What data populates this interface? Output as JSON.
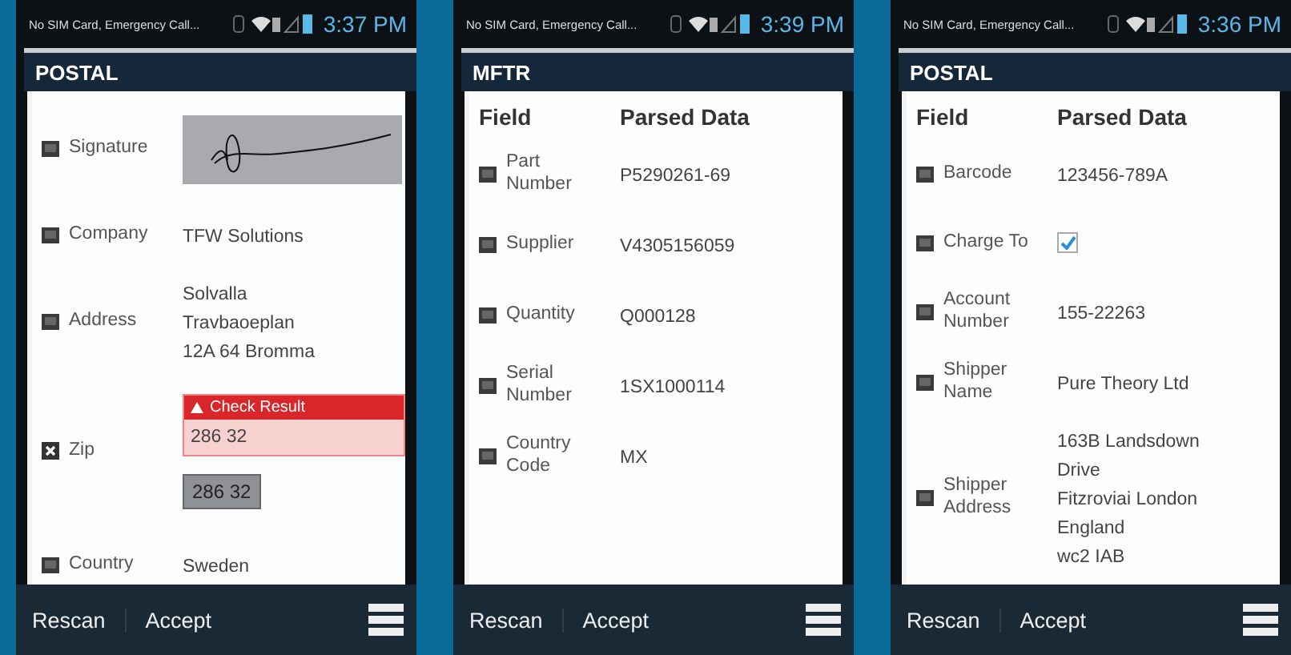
{
  "phones": [
    {
      "status_bar": {
        "carrier": "No SIM Card, Emergency Call...",
        "time": "3:37 PM"
      },
      "title": "POSTAL",
      "rows": [
        {
          "kind": "signature",
          "label": "Signature",
          "error": false
        },
        {
          "kind": "text",
          "label": "Company",
          "error": false,
          "value": "TFW Solutions"
        },
        {
          "kind": "text",
          "label": "Address",
          "error": false,
          "value": "Solvalla\nTravbaoeplan\n12A 64 Bromma"
        },
        {
          "kind": "check",
          "label": "Zip",
          "error": true,
          "alert": "Check Result",
          "value": "286 32",
          "scanned": "286 32"
        },
        {
          "kind": "text",
          "label": "Country",
          "error": false,
          "value": "Sweden"
        }
      ],
      "actions": [
        "Rescan",
        "Accept"
      ]
    },
    {
      "status_bar": {
        "carrier": "No SIM Card, Emergency Call...",
        "time": "3:39 PM"
      },
      "title": "MFTR",
      "columns": [
        "Field",
        "Parsed Data"
      ],
      "rows": [
        {
          "kind": "text",
          "label": "Part\nNumber",
          "error": false,
          "value": "P5290261-69"
        },
        {
          "kind": "text",
          "label": "Supplier",
          "error": false,
          "value": "V4305156059"
        },
        {
          "kind": "text",
          "label": "Quantity",
          "error": false,
          "value": "Q000128"
        },
        {
          "kind": "text",
          "label": "Serial\nNumber",
          "error": false,
          "value": "1SX1000114"
        },
        {
          "kind": "text",
          "label": "Country\nCode",
          "error": false,
          "value": "MX"
        }
      ],
      "actions": [
        "Rescan",
        "Accept"
      ]
    },
    {
      "status_bar": {
        "carrier": "No SIM Card, Emergency Call...",
        "time": "3:36 PM"
      },
      "title": "POSTAL",
      "columns": [
        "Field",
        "Parsed Data"
      ],
      "rows": [
        {
          "kind": "text",
          "label": "Barcode",
          "error": false,
          "value": "123456-789A"
        },
        {
          "kind": "checkbox",
          "label": "Charge To",
          "error": false,
          "checked": true
        },
        {
          "kind": "text",
          "label": "Account\nNumber",
          "error": false,
          "value": "155-22263"
        },
        {
          "kind": "text",
          "label": "Shipper\nName",
          "error": false,
          "value": "Pure Theory Ltd"
        },
        {
          "kind": "text",
          "label": "Shipper\nAddress",
          "error": false,
          "value": "163B Landsdown\nDrive\nFitzroviai London\nEngland\nwc2 IAB"
        }
      ],
      "actions": [
        "Rescan",
        "Accept"
      ]
    }
  ]
}
